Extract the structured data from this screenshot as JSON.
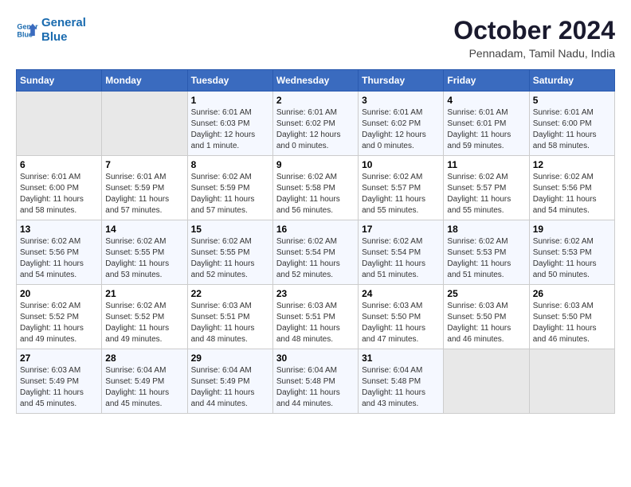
{
  "logo": {
    "line1": "General",
    "line2": "Blue"
  },
  "title": "October 2024",
  "subtitle": "Pennadam, Tamil Nadu, India",
  "headers": [
    "Sunday",
    "Monday",
    "Tuesday",
    "Wednesday",
    "Thursday",
    "Friday",
    "Saturday"
  ],
  "weeks": [
    [
      {
        "day": "",
        "info": ""
      },
      {
        "day": "",
        "info": ""
      },
      {
        "day": "1",
        "info": "Sunrise: 6:01 AM\nSunset: 6:03 PM\nDaylight: 12 hours\nand 1 minute."
      },
      {
        "day": "2",
        "info": "Sunrise: 6:01 AM\nSunset: 6:02 PM\nDaylight: 12 hours\nand 0 minutes."
      },
      {
        "day": "3",
        "info": "Sunrise: 6:01 AM\nSunset: 6:02 PM\nDaylight: 12 hours\nand 0 minutes."
      },
      {
        "day": "4",
        "info": "Sunrise: 6:01 AM\nSunset: 6:01 PM\nDaylight: 11 hours\nand 59 minutes."
      },
      {
        "day": "5",
        "info": "Sunrise: 6:01 AM\nSunset: 6:00 PM\nDaylight: 11 hours\nand 58 minutes."
      }
    ],
    [
      {
        "day": "6",
        "info": "Sunrise: 6:01 AM\nSunset: 6:00 PM\nDaylight: 11 hours\nand 58 minutes."
      },
      {
        "day": "7",
        "info": "Sunrise: 6:01 AM\nSunset: 5:59 PM\nDaylight: 11 hours\nand 57 minutes."
      },
      {
        "day": "8",
        "info": "Sunrise: 6:02 AM\nSunset: 5:59 PM\nDaylight: 11 hours\nand 57 minutes."
      },
      {
        "day": "9",
        "info": "Sunrise: 6:02 AM\nSunset: 5:58 PM\nDaylight: 11 hours\nand 56 minutes."
      },
      {
        "day": "10",
        "info": "Sunrise: 6:02 AM\nSunset: 5:57 PM\nDaylight: 11 hours\nand 55 minutes."
      },
      {
        "day": "11",
        "info": "Sunrise: 6:02 AM\nSunset: 5:57 PM\nDaylight: 11 hours\nand 55 minutes."
      },
      {
        "day": "12",
        "info": "Sunrise: 6:02 AM\nSunset: 5:56 PM\nDaylight: 11 hours\nand 54 minutes."
      }
    ],
    [
      {
        "day": "13",
        "info": "Sunrise: 6:02 AM\nSunset: 5:56 PM\nDaylight: 11 hours\nand 54 minutes."
      },
      {
        "day": "14",
        "info": "Sunrise: 6:02 AM\nSunset: 5:55 PM\nDaylight: 11 hours\nand 53 minutes."
      },
      {
        "day": "15",
        "info": "Sunrise: 6:02 AM\nSunset: 5:55 PM\nDaylight: 11 hours\nand 52 minutes."
      },
      {
        "day": "16",
        "info": "Sunrise: 6:02 AM\nSunset: 5:54 PM\nDaylight: 11 hours\nand 52 minutes."
      },
      {
        "day": "17",
        "info": "Sunrise: 6:02 AM\nSunset: 5:54 PM\nDaylight: 11 hours\nand 51 minutes."
      },
      {
        "day": "18",
        "info": "Sunrise: 6:02 AM\nSunset: 5:53 PM\nDaylight: 11 hours\nand 51 minutes."
      },
      {
        "day": "19",
        "info": "Sunrise: 6:02 AM\nSunset: 5:53 PM\nDaylight: 11 hours\nand 50 minutes."
      }
    ],
    [
      {
        "day": "20",
        "info": "Sunrise: 6:02 AM\nSunset: 5:52 PM\nDaylight: 11 hours\nand 49 minutes."
      },
      {
        "day": "21",
        "info": "Sunrise: 6:02 AM\nSunset: 5:52 PM\nDaylight: 11 hours\nand 49 minutes."
      },
      {
        "day": "22",
        "info": "Sunrise: 6:03 AM\nSunset: 5:51 PM\nDaylight: 11 hours\nand 48 minutes."
      },
      {
        "day": "23",
        "info": "Sunrise: 6:03 AM\nSunset: 5:51 PM\nDaylight: 11 hours\nand 48 minutes."
      },
      {
        "day": "24",
        "info": "Sunrise: 6:03 AM\nSunset: 5:50 PM\nDaylight: 11 hours\nand 47 minutes."
      },
      {
        "day": "25",
        "info": "Sunrise: 6:03 AM\nSunset: 5:50 PM\nDaylight: 11 hours\nand 46 minutes."
      },
      {
        "day": "26",
        "info": "Sunrise: 6:03 AM\nSunset: 5:50 PM\nDaylight: 11 hours\nand 46 minutes."
      }
    ],
    [
      {
        "day": "27",
        "info": "Sunrise: 6:03 AM\nSunset: 5:49 PM\nDaylight: 11 hours\nand 45 minutes."
      },
      {
        "day": "28",
        "info": "Sunrise: 6:04 AM\nSunset: 5:49 PM\nDaylight: 11 hours\nand 45 minutes."
      },
      {
        "day": "29",
        "info": "Sunrise: 6:04 AM\nSunset: 5:49 PM\nDaylight: 11 hours\nand 44 minutes."
      },
      {
        "day": "30",
        "info": "Sunrise: 6:04 AM\nSunset: 5:48 PM\nDaylight: 11 hours\nand 44 minutes."
      },
      {
        "day": "31",
        "info": "Sunrise: 6:04 AM\nSunset: 5:48 PM\nDaylight: 11 hours\nand 43 minutes."
      },
      {
        "day": "",
        "info": ""
      },
      {
        "day": "",
        "info": ""
      }
    ]
  ]
}
